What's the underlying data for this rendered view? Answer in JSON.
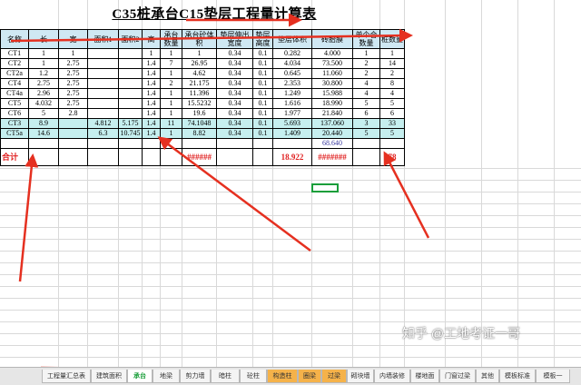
{
  "title": "C35桩承台C15垫层工程量计算表",
  "headers": [
    "名称",
    "长",
    "宽",
    "面积1",
    "面积2",
    "高",
    "承台数量",
    "承台砼体积",
    "垫层伸出宽度",
    "垫层高度",
    "垫层体积",
    "砖胎膜",
    "单个合数量",
    "桩数量"
  ],
  "rows": [
    [
      "CT1",
      "1",
      "1",
      "",
      "",
      "1",
      "1",
      "1",
      "0.34",
      "0.1",
      "0.282",
      "4.000",
      "1",
      "1"
    ],
    [
      "CT2",
      "1",
      "2.75",
      "",
      "",
      "1.4",
      "7",
      "26.95",
      "0.34",
      "0.1",
      "4.034",
      "73.500",
      "2",
      "14"
    ],
    [
      "CT2a",
      "1.2",
      "2.75",
      "",
      "",
      "1.4",
      "1",
      "4.62",
      "0.34",
      "0.1",
      "0.645",
      "11.060",
      "2",
      "2"
    ],
    [
      "CT4",
      "2.75",
      "2.75",
      "",
      "",
      "1.4",
      "2",
      "21.175",
      "0.34",
      "0.1",
      "2.353",
      "30.800",
      "4",
      "8"
    ],
    [
      "CT4a",
      "2.96",
      "2.75",
      "",
      "",
      "1.4",
      "1",
      "11.396",
      "0.34",
      "0.1",
      "1.249",
      "15.988",
      "4",
      "4"
    ],
    [
      "CT5",
      "4.032",
      "2.75",
      "",
      "",
      "1.4",
      "1",
      "15.5232",
      "0.34",
      "0.1",
      "1.616",
      "18.990",
      "5",
      "5"
    ],
    [
      "CT6",
      "5",
      "2.8",
      "",
      "",
      "1.4",
      "1",
      "19.6",
      "0.34",
      "0.1",
      "1.977",
      "21.840",
      "6",
      "6"
    ],
    [
      "CT3",
      "8.9",
      "",
      "4.812",
      "5.175",
      "1.4",
      "11",
      "74.1048",
      "0.34",
      "0.1",
      "5.693",
      "137.060",
      "3",
      "33"
    ],
    [
      "CT5a",
      "14.6",
      "",
      "6.3",
      "10.745",
      "1.4",
      "1",
      "8.82",
      "0.34",
      "0.1",
      "1.409",
      "20.440",
      "5",
      "5"
    ]
  ],
  "subtotal_brick": "68.640",
  "total": {
    "label": "合计",
    "concrete": "######",
    "cushion": "18.922",
    "brick": "#######",
    "piles": "78"
  },
  "tabs": [
    "工程量汇总表",
    "建筑面积",
    "承台",
    "地梁",
    "剪力墙",
    "暗柱",
    "砼柱",
    "构造柱",
    "圈梁",
    "过梁",
    "砌块墙",
    "内墙装修",
    "楼地面",
    "门窗过梁",
    "其他",
    "模板标准",
    "模板一"
  ],
  "active_tab": "承台",
  "watermark": "知乎 @工地考证一哥",
  "colors": {
    "header_fill": "#cfe8f3",
    "highlight_fill": "#c6efef",
    "total_text": "#e02020",
    "arrow": "#e53020",
    "selection": "#1a9e3a",
    "tab_orange": "#f5b24a"
  }
}
